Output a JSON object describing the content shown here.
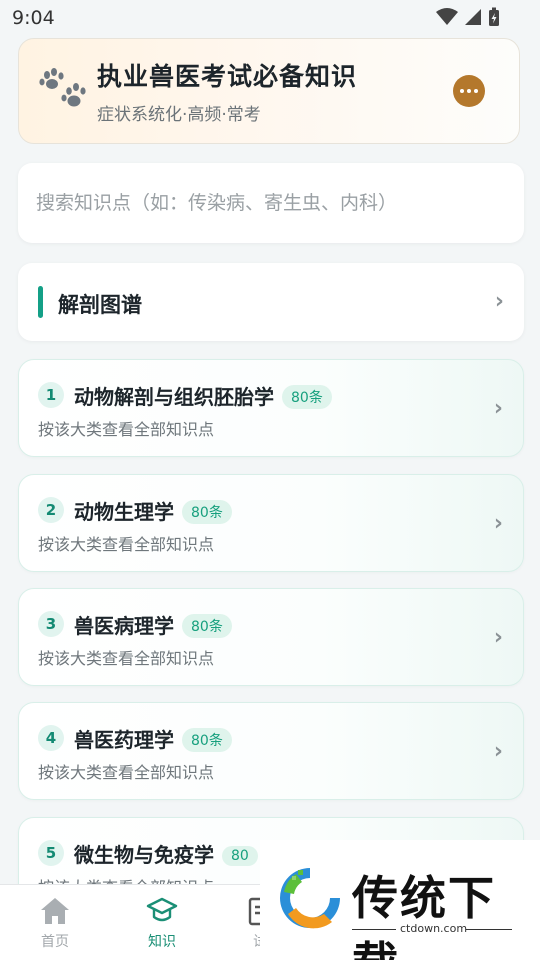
{
  "status_bar": {
    "time": "9:04"
  },
  "header": {
    "title": "执业兽医考试必备知识",
    "subtitle": "症状系统化·高频·常考"
  },
  "search": {
    "placeholder": "搜索知识点（如：传染病、寄生虫、内科）",
    "value": ""
  },
  "anatomy": {
    "label": "解剖图谱"
  },
  "categories": [
    {
      "index": "1",
      "name": "动物解剖与组织胚胎学",
      "count": "80条",
      "desc": "按该大类查看全部知识点"
    },
    {
      "index": "2",
      "name": "动物生理学",
      "count": "80条",
      "desc": "按该大类查看全部知识点"
    },
    {
      "index": "3",
      "name": "兽医病理学",
      "count": "80条",
      "desc": "按该大类查看全部知识点"
    },
    {
      "index": "4",
      "name": "兽医药理学",
      "count": "80条",
      "desc": "按该大类查看全部知识点"
    },
    {
      "index": "5",
      "name": "微生物与免疫学",
      "count": "80",
      "desc": "按该大类查看全部知识点"
    }
  ],
  "tabs": [
    {
      "label": "首页",
      "icon": "home-icon",
      "active": false
    },
    {
      "label": "知识",
      "icon": "graduation-cap-icon",
      "active": true
    },
    {
      "label": "试",
      "icon": "exam-icon",
      "active": false
    }
  ],
  "watermark": {
    "brand": "传统下载",
    "url": "ctdown.com"
  },
  "colors": {
    "accent": "#14a087",
    "brand_orange": "#b4782c",
    "badge_text": "#17a07e"
  }
}
